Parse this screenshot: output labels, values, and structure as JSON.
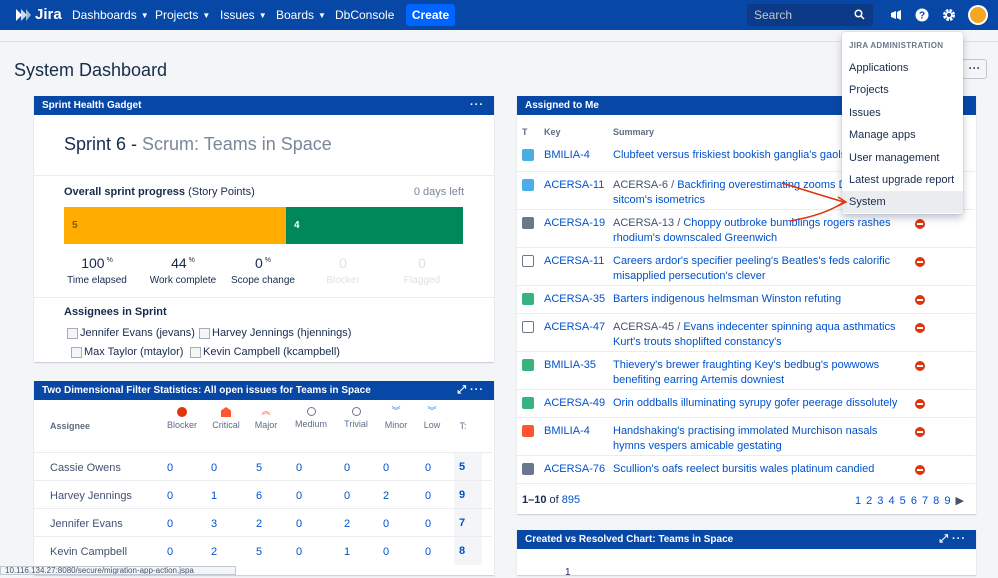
{
  "nav": {
    "logo": "Jira",
    "items": [
      {
        "label": "Dashboards",
        "chevron": true
      },
      {
        "label": "Projects",
        "chevron": true
      },
      {
        "label": "Issues",
        "chevron": true
      },
      {
        "label": "Boards",
        "chevron": true
      },
      {
        "label": "DbConsole",
        "chevron": false
      }
    ],
    "create": "Create",
    "search_placeholder": "Search",
    "icons": [
      "megaphone-icon",
      "help-icon",
      "gear-icon",
      "avatar"
    ]
  },
  "page": {
    "title": "System Dashboard",
    "tools": "···"
  },
  "sprint_gadget": {
    "header": "Sprint Health Gadget",
    "sprint": "Sprint 6 - ",
    "board": "Scrum: Teams in Space",
    "progress_title": "Overall sprint progress",
    "progress_unit": "(Story Points)",
    "days_left": "0 days left",
    "bar": {
      "todo_value": "5",
      "done_value": "4",
      "todo_fraction": 0.556,
      "colors": {
        "todo": "#ffab00",
        "done": "#00875a"
      }
    },
    "stats": [
      {
        "value": "100",
        "unit": "%",
        "label": "Time elapsed",
        "dim": false
      },
      {
        "value": "44",
        "unit": "%",
        "label": "Work complete",
        "dim": false
      },
      {
        "value": "0",
        "unit": "%",
        "label": "Scope change",
        "dim": false
      },
      {
        "value": "0",
        "unit": "",
        "label": "Blocker",
        "dim": true
      },
      {
        "value": "0",
        "unit": "",
        "label": "Flagged",
        "dim": true
      }
    ],
    "assignees_title": "Assignees in Sprint",
    "assignees": [
      "Jennifer Evans (jevans)",
      "Harvey Jennings (hjennings)",
      "Max Taylor (mtaylor)",
      "Kevin Campbell (kcampbell)"
    ]
  },
  "filter_gadget": {
    "header": "Two Dimensional Filter Statistics: All open issues for Teams in Space",
    "col_assignee": "Assignee",
    "columns": [
      "Blocker",
      "Critical",
      "Major",
      "Medium",
      "Trivial",
      "Minor",
      "Low",
      "T:"
    ],
    "rows": [
      {
        "name": "Cassie Owens",
        "values": [
          "0",
          "0",
          "5",
          "0",
          "0",
          "0",
          "0"
        ],
        "total": "5"
      },
      {
        "name": "Harvey Jennings",
        "values": [
          "0",
          "1",
          "6",
          "0",
          "0",
          "2",
          "0"
        ],
        "total": "9"
      },
      {
        "name": "Jennifer Evans",
        "values": [
          "0",
          "3",
          "2",
          "0",
          "2",
          "0",
          "0"
        ],
        "total": "7"
      },
      {
        "name": "Kevin Campbell",
        "values": [
          "0",
          "2",
          "5",
          "0",
          "1",
          "0",
          "0"
        ],
        "total": "8"
      }
    ]
  },
  "assigned_gadget": {
    "header": "Assigned to Me",
    "columns": {
      "t": "T",
      "key": "Key",
      "summary": "Summary"
    },
    "rows": [
      {
        "type_color": "#4bade8",
        "key": "BMILIA-4",
        "parent": "",
        "summary": "Clubfeet versus friskiest bookish ganglia's gaols"
      },
      {
        "type_color": "#4bade8",
        "key": "ACERSA-11",
        "parent": "ACERSA-6 / ",
        "summary": "Backfiring overestimating zooms Dunn Olga's sitcom's isometrics"
      },
      {
        "type_color": "#6b778c",
        "key": "ACERSA-19",
        "parent": "ACERSA-13 / ",
        "summary": "Choppy outbroke bumblings rogers rashes rhodium's downscaled Greenwich"
      },
      {
        "type_color": "#ffffff",
        "key": "ACERSA-11",
        "parent": "",
        "summary": "Careers ardor's specifier peeling's Beatles's feds calorific misapplied persecution's clever"
      },
      {
        "type_color": "#36b37e",
        "key": "ACERSA-35",
        "parent": "",
        "summary": "Barters indigenous helmsman Winston refuting"
      },
      {
        "type_color": "#ffffff",
        "key": "ACERSA-47",
        "parent": "ACERSA-45 / ",
        "summary": "Evans indecenter spinning aqua asthmatics Kurt's trouts shoplifted constancy's"
      },
      {
        "type_color": "#36b37e",
        "key": "BMILIA-35",
        "parent": "",
        "summary": "Thievery's brewer fraughting Key's bedbug's powwows benefiting earring Artemis downiest"
      },
      {
        "type_color": "#36b37e",
        "key": "ACERSA-49",
        "parent": "",
        "summary": "Orin oddballs illuminating syrupy gofer peerage dissolutely"
      },
      {
        "type_color": "#ff5630",
        "key": "BMILIA-4",
        "parent": "",
        "summary": "Handshaking's practising immolated Murchison nasals hymns vespers amicable gestating"
      },
      {
        "type_color": "#6b778c",
        "key": "ACERSA-76",
        "parent": "",
        "summary": "Scullion's oafs reelect bursitis wales platinum candied"
      }
    ],
    "pager_range": "1–10",
    "pager_of": "of",
    "pager_total": "895",
    "pages": "1 2 3 4 5 6 7 8 9"
  },
  "chart_gadget": {
    "header": "Created vs Resolved Chart: Teams in Space",
    "first_tick": "1"
  },
  "admin_menu": {
    "heading": "JIRA ADMINISTRATION",
    "items": [
      "Applications",
      "Projects",
      "Issues",
      "Manage apps",
      "User management",
      "Latest upgrade report",
      "System"
    ],
    "selected": "System"
  },
  "statusbar": {
    "url": "10.116.134.27:8080/secure/migration-app-action.jspa"
  }
}
